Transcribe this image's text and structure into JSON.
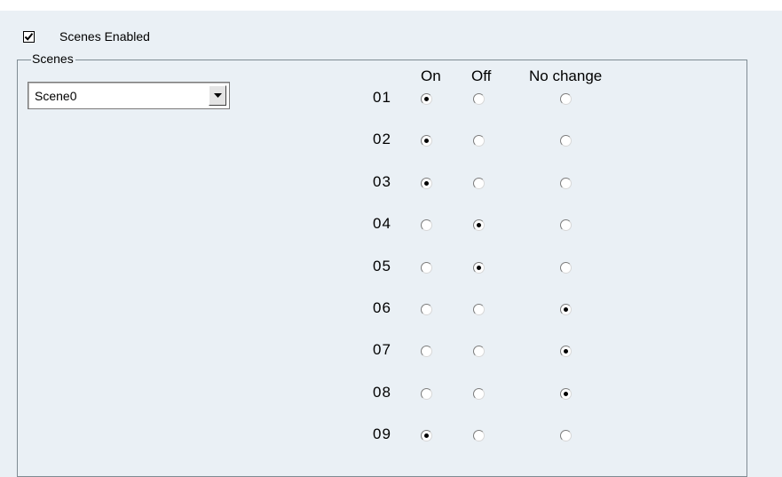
{
  "scenes_enabled": {
    "label": "Scenes Enabled",
    "checked": true
  },
  "scenes_group": {
    "title": "Scenes",
    "selected_scene": "Scene0",
    "columns": [
      "On",
      "Off",
      "No change"
    ],
    "rows": [
      {
        "label": "01",
        "state": "On"
      },
      {
        "label": "02",
        "state": "On"
      },
      {
        "label": "03",
        "state": "On"
      },
      {
        "label": "04",
        "state": "Off"
      },
      {
        "label": "05",
        "state": "Off"
      },
      {
        "label": "06",
        "state": "No change"
      },
      {
        "label": "07",
        "state": "No change"
      },
      {
        "label": "08",
        "state": "No change"
      },
      {
        "label": "09",
        "state": "On"
      }
    ]
  }
}
